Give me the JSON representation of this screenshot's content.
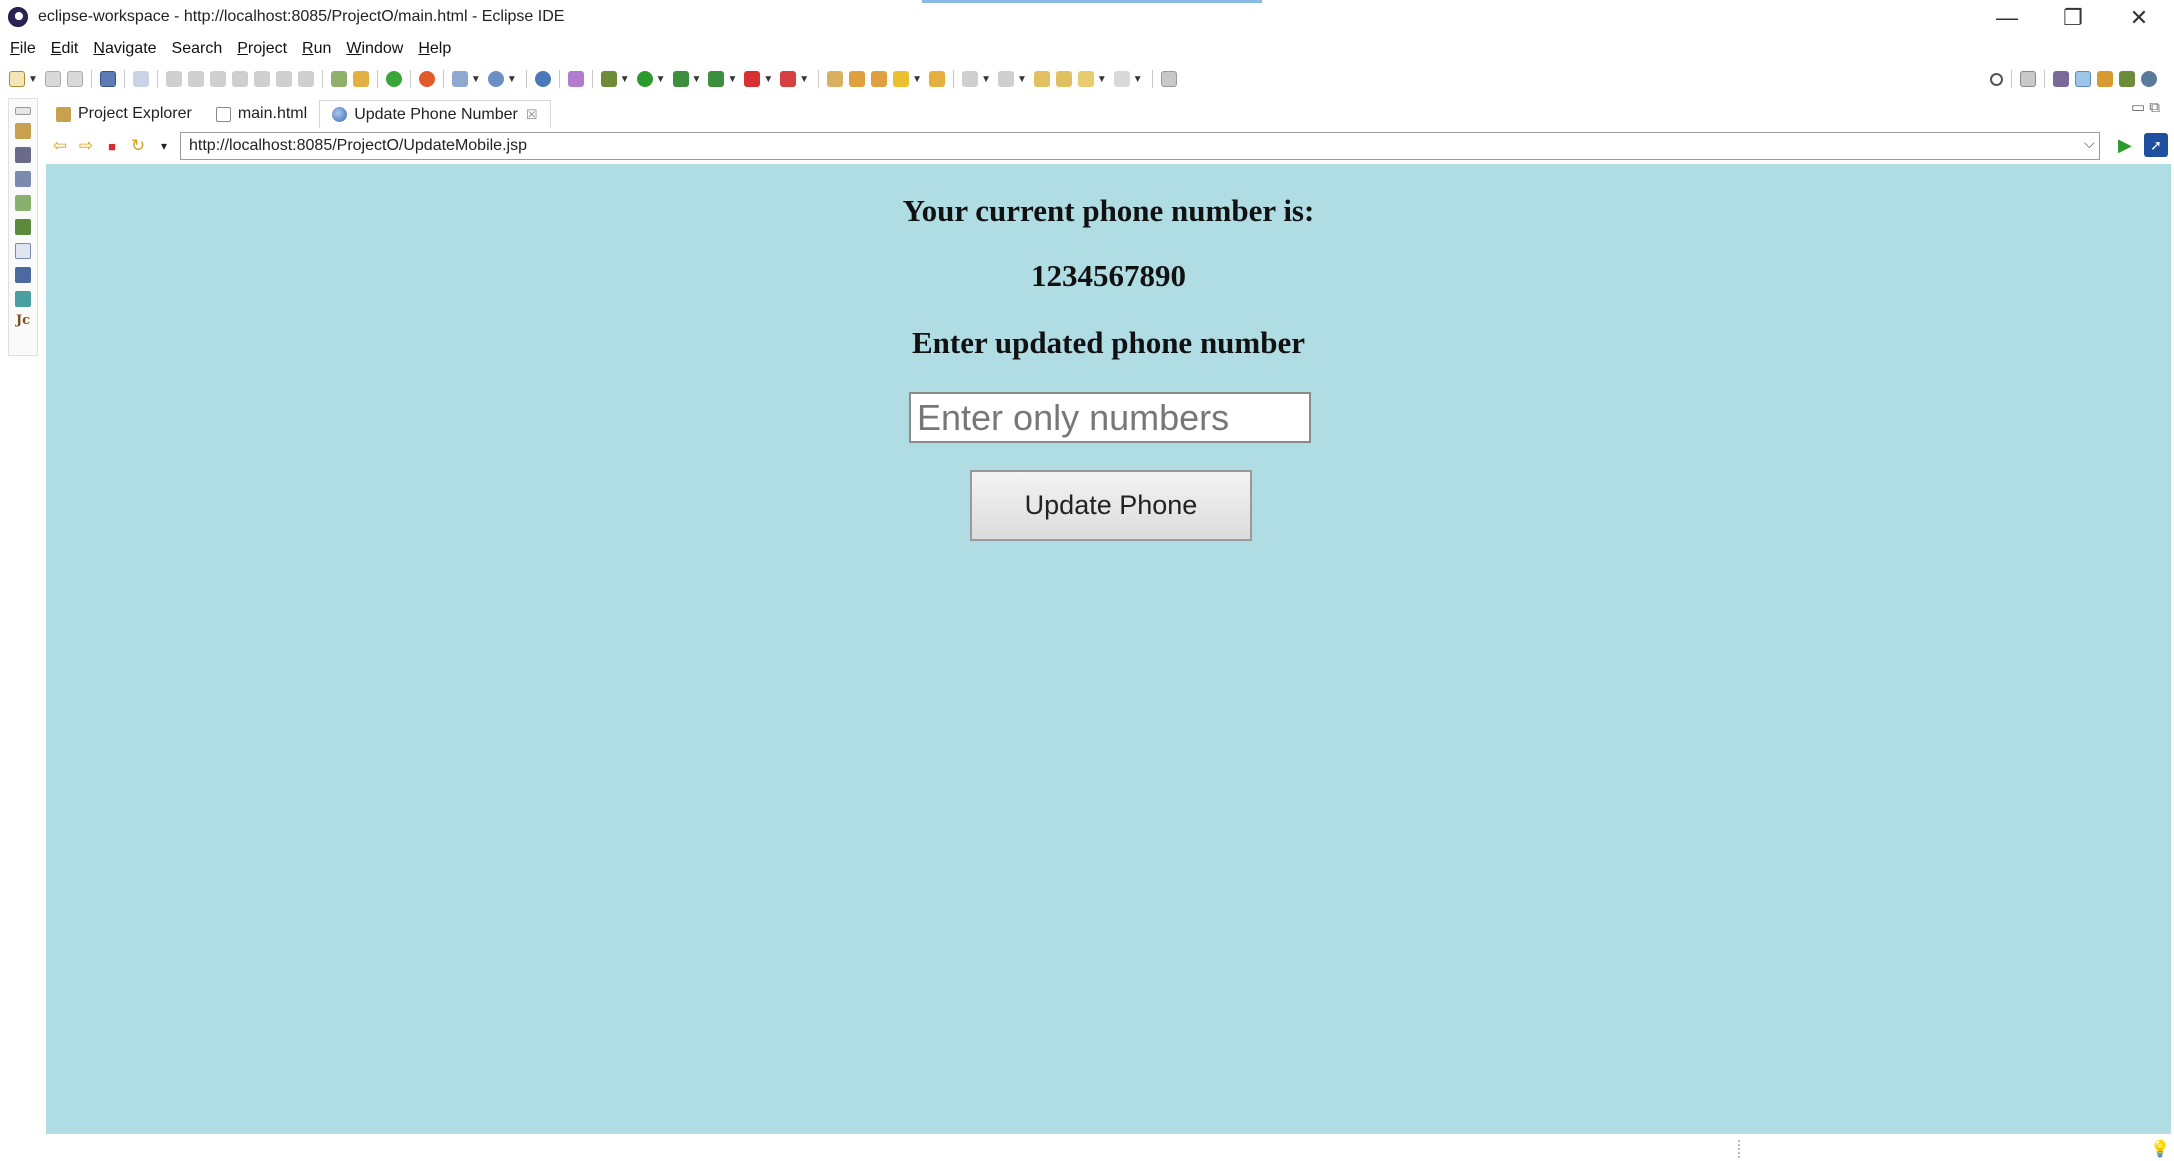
{
  "window": {
    "title": "eclipse-workspace - http://localhost:8085/ProjectO/main.html - Eclipse IDE",
    "minimize": "—",
    "maximize": "❐",
    "close": "✕"
  },
  "menu": [
    {
      "accel": "F",
      "rest": "ile"
    },
    {
      "accel": "E",
      "rest": "dit"
    },
    {
      "accel": "N",
      "rest": "avigate"
    },
    {
      "accel": "",
      "rest": "Search"
    },
    {
      "accel": "P",
      "rest": "roject"
    },
    {
      "accel": "R",
      "rest": "un"
    },
    {
      "accel": "W",
      "rest": "indow"
    },
    {
      "accel": "H",
      "rest": "elp"
    }
  ],
  "tabs": {
    "project_explorer": "Project Explorer",
    "main_html": "main.html",
    "update_phone": "Update Phone Number",
    "close_glyph": "☒",
    "controls": "▭  ⧉"
  },
  "browser": {
    "url": "http://localhost:8085/ProjectO/UpdateMobile.jsp",
    "back": "⇦",
    "forward": "⇨",
    "stop": "■",
    "refresh": "↻",
    "menu": "▾",
    "dropdown": "⌵",
    "go": "▶",
    "open_external": "➚"
  },
  "page": {
    "heading_current": "Your current phone number is:",
    "current_number": "1234567890",
    "heading_enter": "Enter updated phone number",
    "input_placeholder": "Enter only numbers",
    "button_label": "Update Phone"
  },
  "left_trim": {
    "java_label": "Jc"
  },
  "status": {
    "tip_icon": "💡"
  },
  "colors": {
    "page_background": "#b0dde4",
    "url_border": "#9a9a9a"
  }
}
